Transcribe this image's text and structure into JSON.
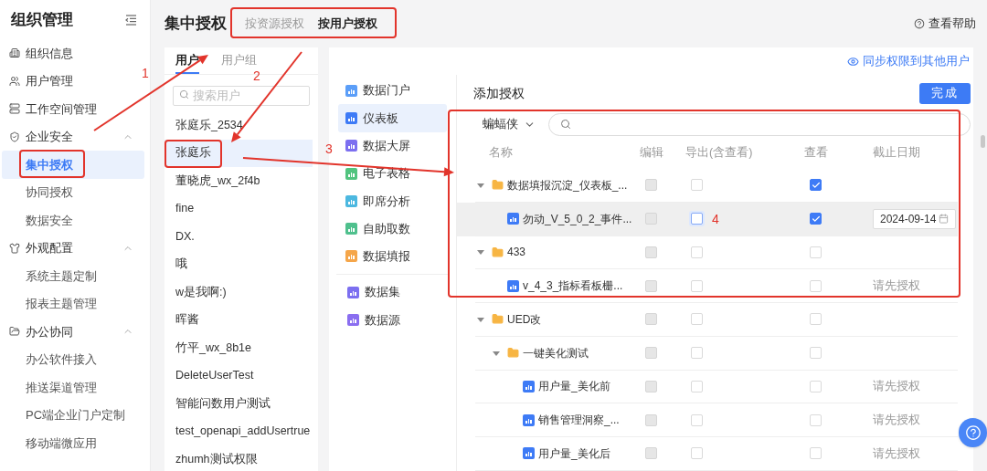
{
  "sidebar": {
    "title": "组织管理",
    "items": [
      {
        "label": "组织信息",
        "selected": false
      },
      {
        "label": "用户管理",
        "selected": false
      },
      {
        "label": "工作空间管理",
        "selected": false
      },
      {
        "label": "企业安全",
        "selected": false,
        "expanded": true,
        "children": [
          {
            "label": "集中授权",
            "selected": true
          },
          {
            "label": "协同授权",
            "selected": false
          },
          {
            "label": "数据安全",
            "selected": false
          }
        ]
      },
      {
        "label": "外观配置",
        "selected": false,
        "expanded": true,
        "children": [
          {
            "label": "系统主题定制",
            "selected": false
          },
          {
            "label": "报表主题管理",
            "selected": false
          }
        ]
      },
      {
        "label": "办公协同",
        "selected": false,
        "expanded": true,
        "children": [
          {
            "label": "办公软件接入",
            "selected": false
          },
          {
            "label": "推送渠道管理",
            "selected": false
          },
          {
            "label": "PC端企业门户定制",
            "selected": false
          },
          {
            "label": "移动端微应用",
            "selected": false
          }
        ]
      }
    ]
  },
  "header": {
    "title": "集中授权",
    "tabs": [
      {
        "label": "按资源授权",
        "selected": false
      },
      {
        "label": "按用户授权",
        "selected": true
      }
    ],
    "help_link": "查看帮助"
  },
  "user_panel": {
    "tabs": [
      {
        "label": "用户",
        "selected": true
      },
      {
        "label": "用户组",
        "selected": false
      }
    ],
    "search": {
      "placeholder": "搜索用户"
    },
    "users": [
      {
        "name": "张庭乐_2534",
        "selected": false
      },
      {
        "name": "张庭乐",
        "selected": true
      },
      {
        "name": "董晓虎_wx_2f4b",
        "selected": false
      },
      {
        "name": "fine",
        "selected": false
      },
      {
        "name": "DX.",
        "selected": false
      },
      {
        "name": "哦",
        "selected": false
      },
      {
        "name": "w是我啊:)",
        "selected": false
      },
      {
        "name": "晖酱",
        "selected": false
      },
      {
        "name": "竹平_wx_8b1e",
        "selected": false
      },
      {
        "name": "DeleteUserTest",
        "selected": false
      },
      {
        "name": "智能问数用户测试",
        "selected": false
      },
      {
        "name": "test_openapi_addUsertrue",
        "selected": false
      },
      {
        "name": "zhumh测试权限",
        "selected": false
      }
    ]
  },
  "resources": {
    "sync_link": "同步权限到其他用户",
    "category_groups": [
      [
        {
          "label": "数据门户",
          "selected": false,
          "color": "#5b9ef8"
        },
        {
          "label": "仪表板",
          "selected": true,
          "color": "#3e7bf6"
        },
        {
          "label": "数据大屏",
          "selected": false,
          "color": "#7c6ff0"
        },
        {
          "label": "电子表格",
          "selected": false,
          "color": "#52c47f"
        },
        {
          "label": "即席分析",
          "selected": false,
          "color": "#4cb8e0"
        },
        {
          "label": "自助取数",
          "selected": false,
          "color": "#4fc08d"
        },
        {
          "label": "数据填报",
          "selected": false,
          "color": "#f5a64a"
        }
      ],
      [
        {
          "label": "数据集",
          "selected": false,
          "color": "#7c6ff0"
        },
        {
          "label": "数据源",
          "selected": false,
          "color": "#8a6ef0"
        }
      ]
    ]
  },
  "authorization": {
    "title": "添加授权",
    "done_button": "完成",
    "owner_filter": "蝙蝠侠",
    "columns": [
      "名称",
      "编辑",
      "导出(含查看)",
      "查看",
      "截止日期"
    ],
    "rows": [
      {
        "kind": "folder",
        "name": "数据填报沉淀_仪表板_...",
        "expanded": true,
        "hovered": false,
        "permissions": [
          {
            "checked": false,
            "disabled": true,
            "focused": false
          },
          {
            "checked": false,
            "disabled": false,
            "focused": false
          },
          {
            "checked": true,
            "disabled": false,
            "focused": false
          }
        ],
        "children": [
          {
            "kind": "dashboard",
            "name": "勿动_V_5_0_2_事件...",
            "hovered": true,
            "permissions": [
              {
                "checked": false,
                "disabled": true,
                "focused": false
              },
              {
                "checked": false,
                "disabled": false,
                "focused": true
              },
              {
                "checked": true,
                "disabled": false,
                "focused": false
              }
            ],
            "deadline": {
              "kind": "date",
              "value": "2024-09-14"
            }
          }
        ]
      },
      {
        "kind": "folder",
        "name": "433",
        "expanded": true,
        "hovered": false,
        "permissions": [
          {
            "checked": false,
            "disabled": true,
            "focused": false
          },
          {
            "checked": false,
            "disabled": false,
            "focused": false
          },
          {
            "checked": false,
            "disabled": false,
            "focused": false
          }
        ],
        "children": [
          {
            "kind": "dashboard",
            "name": "v_4_3_指标看板栅...",
            "hovered": false,
            "permissions": [
              {
                "checked": false,
                "disabled": true,
                "focused": false
              },
              {
                "checked": false,
                "disabled": false,
                "focused": false
              },
              {
                "checked": false,
                "disabled": false,
                "focused": false
              }
            ],
            "deadline": {
              "kind": "note",
              "text": "请先授权"
            }
          }
        ]
      },
      {
        "kind": "folder",
        "name": "UED改",
        "expanded": true,
        "hovered": false,
        "permissions": [
          {
            "checked": false,
            "disabled": true,
            "focused": false
          },
          {
            "checked": false,
            "disabled": false,
            "focused": false
          },
          {
            "checked": false,
            "disabled": false,
            "focused": false
          }
        ],
        "children": [
          {
            "kind": "folder",
            "name": "一键美化测试",
            "expanded": true,
            "hovered": false,
            "permissions": [
              {
                "checked": false,
                "disabled": true,
                "focused": false
              },
              {
                "checked": false,
                "disabled": false,
                "focused": false
              },
              {
                "checked": false,
                "disabled": false,
                "focused": false
              }
            ],
            "children": [
              {
                "kind": "dashboard",
                "name": "用户量_美化前",
                "hovered": false,
                "permissions": [
                  {
                    "checked": false,
                    "disabled": true,
                    "focused": false
                  },
                  {
                    "checked": false,
                    "disabled": false,
                    "focused": false
                  },
                  {
                    "checked": false,
                    "disabled": false,
                    "focused": false
                  }
                ],
                "deadline": {
                  "kind": "note",
                  "text": "请先授权"
                }
              },
              {
                "kind": "dashboard",
                "name": "销售管理洞察_...",
                "hovered": false,
                "permissions": [
                  {
                    "checked": false,
                    "disabled": true,
                    "focused": false
                  },
                  {
                    "checked": false,
                    "disabled": false,
                    "focused": false
                  },
                  {
                    "checked": false,
                    "disabled": false,
                    "focused": false
                  }
                ],
                "deadline": {
                  "kind": "note",
                  "text": "请先授权"
                }
              },
              {
                "kind": "dashboard",
                "name": "用户量_美化后",
                "hovered": false,
                "permissions": [
                  {
                    "checked": false,
                    "disabled": true,
                    "focused": false
                  },
                  {
                    "checked": false,
                    "disabled": false,
                    "focused": false
                  },
                  {
                    "checked": false,
                    "disabled": false,
                    "focused": false
                  }
                ],
                "deadline": {
                  "kind": "note",
                  "text": "请先授权"
                }
              }
            ]
          }
        ]
      }
    ]
  },
  "annotations": [
    {
      "label": "1"
    },
    {
      "label": "2"
    },
    {
      "label": "3"
    },
    {
      "label": "4"
    }
  ]
}
